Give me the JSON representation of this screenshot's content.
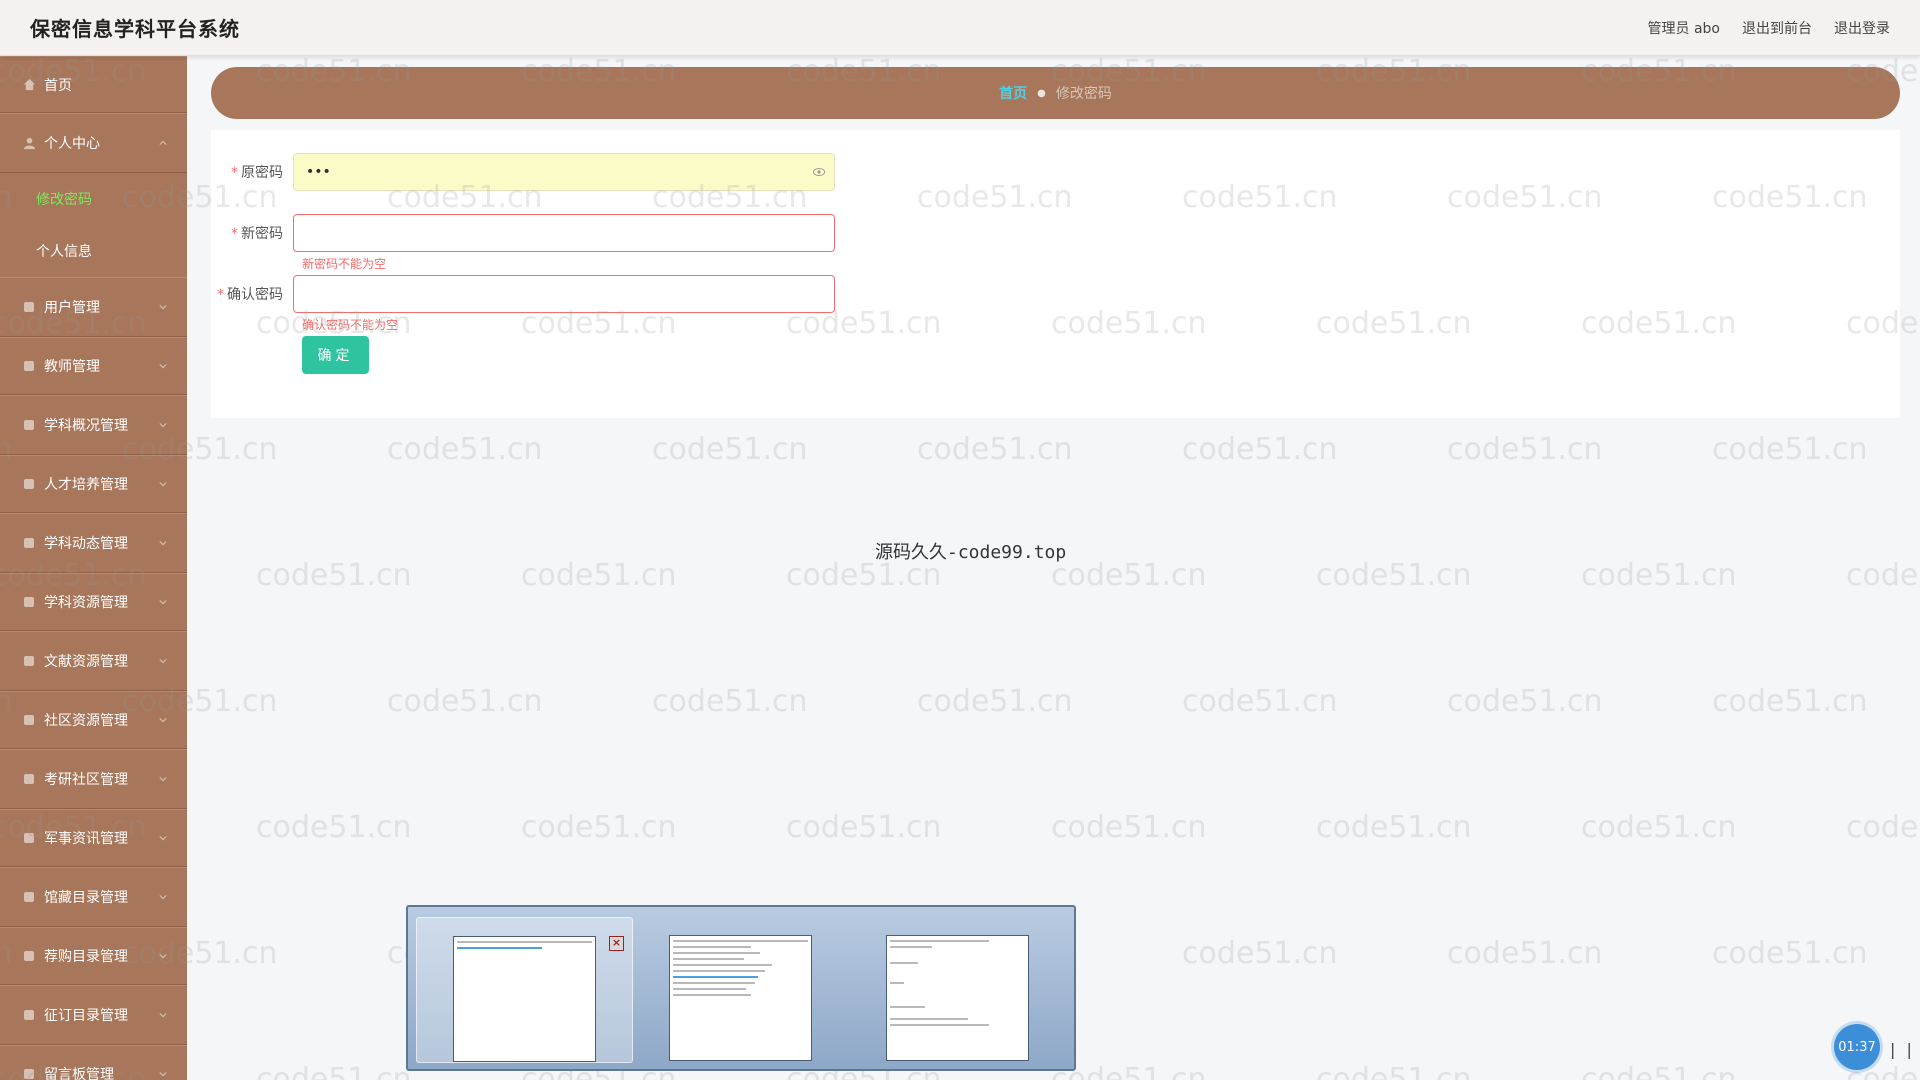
{
  "header": {
    "app_title": "保密信息学科平台系统",
    "user_label": "管理员 abo",
    "to_frontend": "退出到前台",
    "logout": "退出登录"
  },
  "sidebar": {
    "home": "首页",
    "personal_center": "个人中心",
    "sub_items": [
      "修改密码",
      "个人信息"
    ],
    "items": [
      "用户管理",
      "教师管理",
      "学科概况管理",
      "人才培养管理",
      "学科动态管理",
      "学科资源管理",
      "文献资源管理",
      "社区资源管理",
      "考研社区管理",
      "军事资讯管理",
      "馆藏目录管理",
      "荐购目录管理",
      "征订目录管理",
      "留言板管理"
    ]
  },
  "breadcrumb": {
    "home": "首页",
    "current": "修改密码"
  },
  "form": {
    "old_password_label": "原密码",
    "old_password_value": "•••",
    "new_password_label": "新密码",
    "new_password_error": "新密码不能为空",
    "confirm_password_label": "确认密码",
    "confirm_password_error": "确认密码不能为空",
    "submit_label": "确定"
  },
  "watermark_text": "code51.cn",
  "center_note": "源码久久-code99.top",
  "timer": "01:37",
  "pause": "| |"
}
